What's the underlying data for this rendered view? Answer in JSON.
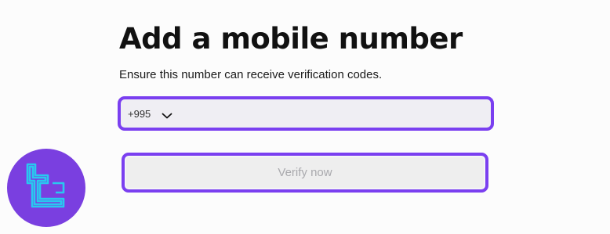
{
  "form": {
    "title": "Add a mobile number",
    "subtitle": "Ensure this number can receive verification codes.",
    "country_code": "+995",
    "phone_value": "",
    "phone_placeholder": "",
    "verify_label": "Verify now"
  },
  "icons": {
    "country_dropdown": "chevron-down-icon",
    "logo": "brand-logo"
  },
  "colors": {
    "accent": "#7a3ff0",
    "field_background": "#efeef3",
    "button_background": "#eeeeee",
    "button_text_disabled": "#a9a9ad",
    "logo_background": "#7a3fe0",
    "logo_mark": "#29c8f0"
  }
}
